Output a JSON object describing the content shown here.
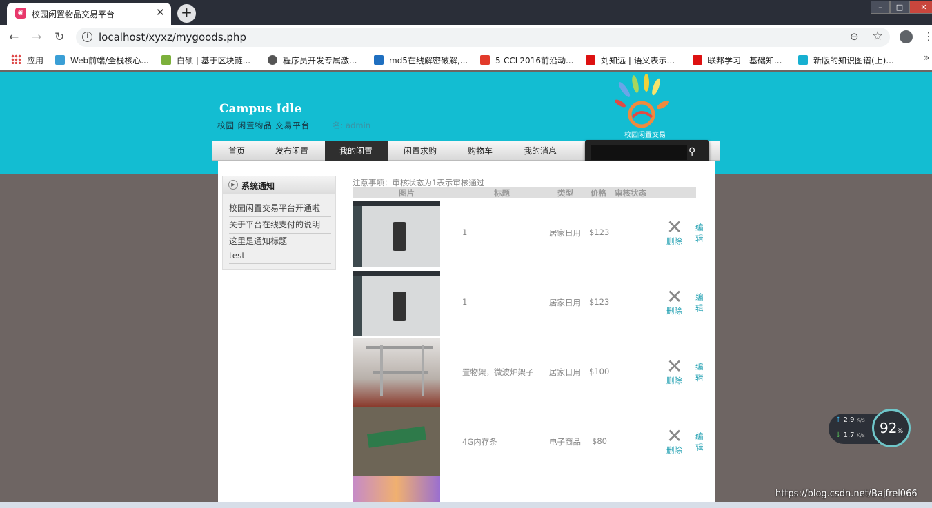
{
  "browser": {
    "tab_title": "校园闲置物品交易平台",
    "tab_close": "✕",
    "new_tab": "+",
    "url": "localhost/xyxz/mygoods.php",
    "window_controls": [
      "–",
      "□",
      "✕"
    ],
    "nav_icons": {
      "back": "←",
      "forward": "→",
      "reload": "↻"
    },
    "bookmarks": [
      {
        "label": "应用",
        "color": "#d44"
      },
      {
        "label": "Web前端/全栈核心...",
        "color": "#3a9fd6"
      },
      {
        "label": "白硕 | 基于区块链...",
        "color": "#7cb03b"
      },
      {
        "label": "程序员开发专属激...",
        "color": "#555"
      },
      {
        "label": "md5在线解密破解,...",
        "color": "#1f6fc0"
      },
      {
        "label": "5-CCL2016前沿动...",
        "color": "#e23a2b"
      },
      {
        "label": "刘知远 | 语义表示...",
        "color": "#d11"
      },
      {
        "label": "联邦学习 - 基础知...",
        "color": "#d11"
      },
      {
        "label": "新版的知识图谱(上)...",
        "color": "#17b0d1"
      }
    ],
    "bookmarks_more": "»"
  },
  "site": {
    "title": "Campus Idle",
    "subtitle": "校园  闲置物品  交易平台",
    "user_line": "名: admin",
    "logo_caption": "校园闲置交易",
    "nav": [
      "首页",
      "发布闲置",
      "我的闲置",
      "闲置求购",
      "购物车",
      "我的消息"
    ],
    "active_nav": "我的闲置"
  },
  "sidebar": {
    "title": "系统通知",
    "items": [
      "校园闲置交易平台开通啦",
      "关于平台在线支付的说明",
      "这里是通知标题",
      "test"
    ]
  },
  "main": {
    "tip": "注意事项：审核状态为1表示审核通过",
    "headers": [
      "图片",
      "标题",
      "类型",
      "价格",
      "审核状态"
    ],
    "delete_label": "删除",
    "edit_label": "编辑",
    "delete_icon": "✕",
    "rows": [
      {
        "title": "1",
        "type": "居家日用",
        "price": "$123",
        "thumb_color": "#d6d9da"
      },
      {
        "title": "1",
        "type": "居家日用",
        "price": "$123",
        "thumb_color": "#d6d9da"
      },
      {
        "title": "置物架，微波炉架子",
        "type": "居家日用",
        "price": "$100",
        "thumb_color": "#b9b3ad"
      },
      {
        "title": "4G内存条",
        "type": "电子商品",
        "price": "$80",
        "thumb_color": "#6b6152"
      }
    ]
  },
  "overlay": {
    "upload": "2.9",
    "download": "1.7",
    "speed_unit": "K/s",
    "percent": "92",
    "percent_unit": "%",
    "watermark": "https://blog.csdn.net/Bajfrel066"
  }
}
